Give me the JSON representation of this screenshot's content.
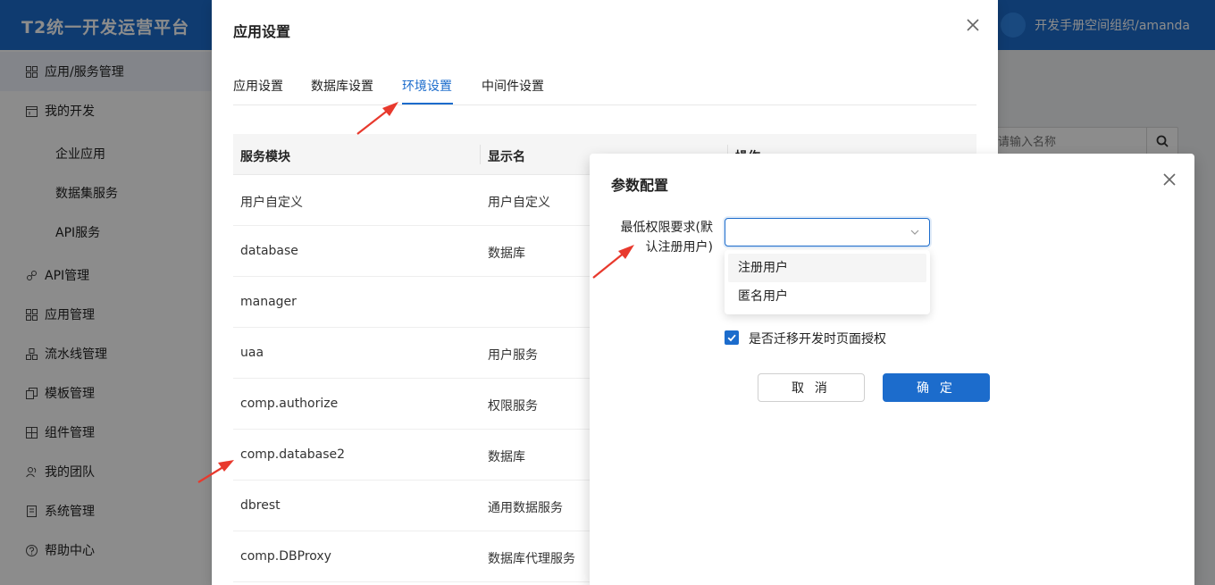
{
  "app": {
    "title": "T2统一开发运营平台",
    "user": "开发手册空间组织/amanda"
  },
  "sidebar": {
    "items": [
      {
        "label": "应用/服务管理",
        "icon": "grid-icon"
      },
      {
        "label": "我的开发",
        "icon": "calendar-icon"
      },
      {
        "label": "企业应用",
        "icon": ""
      },
      {
        "label": "数据集服务",
        "icon": ""
      },
      {
        "label": "API服务",
        "icon": ""
      },
      {
        "label": "API管理",
        "icon": "link-icon"
      },
      {
        "label": "应用管理",
        "icon": "apps-icon"
      },
      {
        "label": "流水线管理",
        "icon": "pipeline-icon"
      },
      {
        "label": "模板管理",
        "icon": "copy-icon"
      },
      {
        "label": "组件管理",
        "icon": "component-icon"
      },
      {
        "label": "我的团队",
        "icon": "team-icon"
      },
      {
        "label": "系统管理",
        "icon": "document-icon"
      },
      {
        "label": "帮助中心",
        "icon": "help-icon"
      }
    ]
  },
  "search": {
    "placeholder": "请输入名称"
  },
  "app_dialog": {
    "title": "应用设置",
    "tabs": [
      "应用设置",
      "数据库设置",
      "环境设置",
      "中间件设置"
    ],
    "active_tab": 2,
    "columns": [
      "服务模块",
      "显示名",
      "操作"
    ],
    "rows": [
      {
        "module": "用户自定义",
        "display": "用户自定义"
      },
      {
        "module": "database",
        "display": "数据库"
      },
      {
        "module": "manager",
        "display": ""
      },
      {
        "module": "uaa",
        "display": "用户服务"
      },
      {
        "module": "comp.authorize",
        "display": "权限服务"
      },
      {
        "module": "comp.database2",
        "display": "数据库"
      },
      {
        "module": "dbrest",
        "display": "通用数据服务"
      },
      {
        "module": "comp.DBProxy",
        "display": "数据库代理服务"
      }
    ]
  },
  "param_dialog": {
    "title": "参数配置",
    "field_label_line1": "最低权限要求(默",
    "field_label_line2": "认注册用户)",
    "select_value": "",
    "options": [
      "注册用户",
      "匿名用户"
    ],
    "checkbox_label": "是否迁移开发时页面授权",
    "checkbox_checked": true,
    "cancel_label": "取 消",
    "ok_label": "确 定"
  },
  "colors": {
    "primary": "#1c6ccc",
    "annotation": "#e8392d"
  }
}
